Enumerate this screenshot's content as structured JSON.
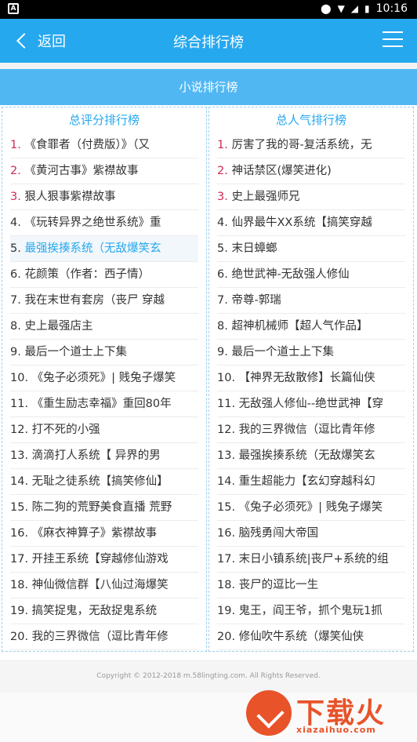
{
  "status_bar": {
    "time": "10:16"
  },
  "header": {
    "back_label": "返回",
    "title": "综合排行榜"
  },
  "banner": {
    "label": "小说排行榜"
  },
  "left_panel": {
    "title": "总评分排行榜",
    "items": [
      {
        "num": "1.",
        "text": "《食罪者（付费版）》（又"
      },
      {
        "num": "2.",
        "text": "《黄河古事》紫襟故事"
      },
      {
        "num": "3.",
        "text": "狠人狠事紫襟故事"
      },
      {
        "num": "4.",
        "text": "《玩转异界之绝世系统》重"
      },
      {
        "num": "5.",
        "text": "最强挨揍系统（无敌爆笑玄"
      },
      {
        "num": "6.",
        "text": "花颜策（作者：西子情）"
      },
      {
        "num": "7.",
        "text": "我在末世有套房（丧尸 穿越"
      },
      {
        "num": "8.",
        "text": "史上最强店主"
      },
      {
        "num": "9.",
        "text": "最后一个道士上下集"
      },
      {
        "num": "10.",
        "text": "《兔子必须死》| 贱兔子爆笑"
      },
      {
        "num": "11.",
        "text": "《重生励志幸福》重回80年"
      },
      {
        "num": "12.",
        "text": "打不死的小强"
      },
      {
        "num": "13.",
        "text": "滴滴打人系统【 异界的男"
      },
      {
        "num": "14.",
        "text": "无耻之徒系统【搞笑修仙】"
      },
      {
        "num": "15.",
        "text": "陈二狗的荒野美食直播 荒野"
      },
      {
        "num": "16.",
        "text": "《麻衣神算子》紫襟故事"
      },
      {
        "num": "17.",
        "text": "开挂王系统【穿越修仙游戏"
      },
      {
        "num": "18.",
        "text": "神仙微信群【八仙过海爆笑"
      },
      {
        "num": "19.",
        "text": "搞笑捉鬼，无敌捉鬼系统"
      },
      {
        "num": "20.",
        "text": "我的三界微信（逗比青年修"
      }
    ]
  },
  "right_panel": {
    "title": "总人气排行榜",
    "items": [
      {
        "num": "1.",
        "text": "厉害了我的哥-复活系统，无"
      },
      {
        "num": "2.",
        "text": "神话禁区(爆笑进化)"
      },
      {
        "num": "3.",
        "text": "史上最强师兄"
      },
      {
        "num": "4.",
        "text": "仙界最牛XX系统【搞笑穿越"
      },
      {
        "num": "5.",
        "text": "末日蟑螂"
      },
      {
        "num": "6.",
        "text": "绝世武神-无敌强人修仙"
      },
      {
        "num": "7.",
        "text": "帝尊-郭瑞"
      },
      {
        "num": "8.",
        "text": "超神机械师【超人气作品】"
      },
      {
        "num": "9.",
        "text": "最后一个道士上下集"
      },
      {
        "num": "10.",
        "text": "【神界无敌散修】长篇仙侠"
      },
      {
        "num": "11.",
        "text": "无敌强人修仙--绝世武神【穿"
      },
      {
        "num": "12.",
        "text": "我的三界微信（逗比青年修"
      },
      {
        "num": "13.",
        "text": "最强挨揍系统（无敌爆笑玄"
      },
      {
        "num": "14.",
        "text": "重生超能力【玄幻穿越科幻"
      },
      {
        "num": "15.",
        "text": "《兔子必须死》| 贱兔子爆笑"
      },
      {
        "num": "16.",
        "text": "脑残勇闯大帝国"
      },
      {
        "num": "17.",
        "text": "末日小镇系统|丧尸+系统的组"
      },
      {
        "num": "18.",
        "text": "丧尸的逗比一生"
      },
      {
        "num": "19.",
        "text": "鬼王，阎王爷，抓个鬼玩1抓"
      },
      {
        "num": "20.",
        "text": "修仙吹牛系统（爆笑仙侠"
      }
    ]
  },
  "footer": {
    "copyright": "Copyright © 2012-2018 m.58lingting.com. All Rights Reserved."
  },
  "watermark": {
    "title": "下载火",
    "domain": "xiazaihuo.com"
  },
  "colors": {
    "accent": "#26a8ef",
    "banner": "#50b7f3",
    "top_rank": "#cf2b55"
  }
}
